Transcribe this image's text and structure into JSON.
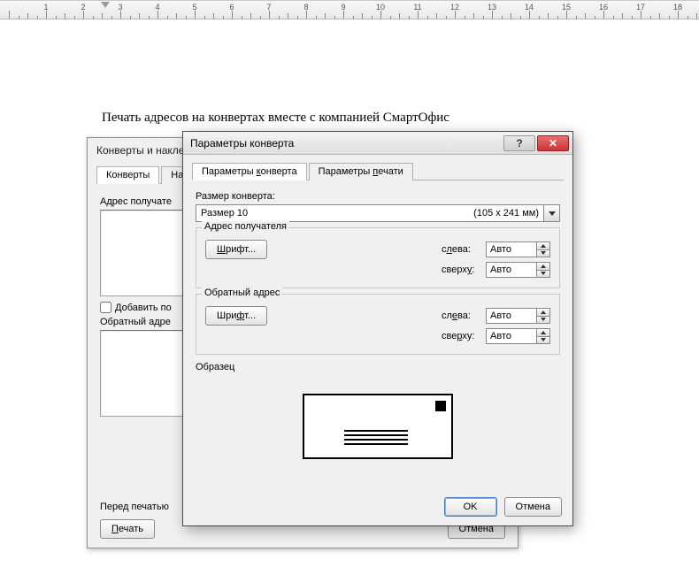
{
  "document_heading": "Печать адресов на конвертах вместе с компанией СмартОфис",
  "back_dialog": {
    "title": "Конверты и накле",
    "tabs": {
      "envelopes": "Конверты",
      "labels": "Нак"
    },
    "recipient_label": "Адрес получате",
    "add_electronic": "Добавить по",
    "return_label": "Обратный адре",
    "before_print": "Перед печатью",
    "print_btn": "Печать",
    "cancel_btn": "Отмена"
  },
  "front_dialog": {
    "title": "Параметры конверта",
    "tabs": {
      "params": "Параметры конверта",
      "print": "Параметры печати"
    },
    "size_label": "Размер конверта:",
    "size_name": "Размер 10",
    "size_dims": "(105 x 241 мм)",
    "recipient_group": "Адрес получателя",
    "return_group": "Обратный адрес",
    "font_btn": "Шрифт...",
    "left_lbl": "слева:",
    "top_lbl": "сверху:",
    "auto": "Авто",
    "preview_lbl": "Образец",
    "ok": "OK",
    "cancel": "Отмена"
  }
}
